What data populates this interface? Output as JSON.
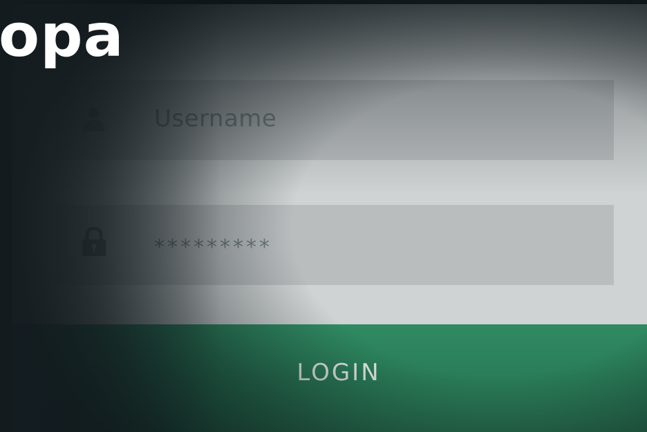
{
  "headline": "opa",
  "login_form": {
    "username_placeholder": "Username",
    "password_masked": "*********",
    "login_label": "LOGIN"
  },
  "icons": {
    "username": "user-icon",
    "password": "lock-icon"
  },
  "colors": {
    "login_button": "#2f8a62",
    "field_background": "#b9bdbe",
    "panel_background": "#cfd3d3",
    "placeholder_text": "#7c8689"
  }
}
